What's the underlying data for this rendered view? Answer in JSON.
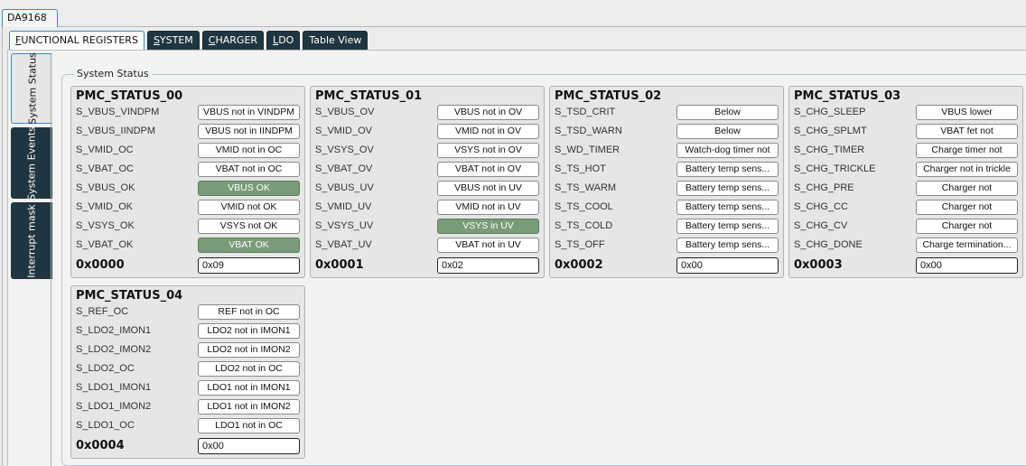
{
  "device": {
    "label": "DA9168"
  },
  "tabs": [
    {
      "prefix": "F",
      "rest": "UNCTIONAL REGISTERS",
      "active": true
    },
    {
      "prefix": "S",
      "rest": "YSTEM",
      "active": false
    },
    {
      "prefix": "C",
      "rest": "HARGER",
      "active": false
    },
    {
      "prefix": "L",
      "rest": "DO",
      "active": false
    },
    {
      "prefix": "",
      "rest": "Table View",
      "active": false
    }
  ],
  "side_tabs": [
    {
      "label": "System Status",
      "active": true
    },
    {
      "label": "System Events",
      "active": false
    },
    {
      "label": "Interrupt mask",
      "active": false
    }
  ],
  "group": {
    "label": "System Status"
  },
  "registers": [
    {
      "title": "PMC_STATUS_00",
      "address": "0x0000",
      "value": "0x09",
      "rows": [
        {
          "name": "S_VBUS_VINDPM",
          "value": "VBUS not in VINDPM",
          "on": false
        },
        {
          "name": "S_VBUS_IINDPM",
          "value": "VBUS not in IINDPM",
          "on": false
        },
        {
          "name": "S_VMID_OC",
          "value": "VMID not in OC",
          "on": false
        },
        {
          "name": "S_VBAT_OC",
          "value": "VBAT not in OC",
          "on": false
        },
        {
          "name": "S_VBUS_OK",
          "value": "VBUS OK",
          "on": true
        },
        {
          "name": "S_VMID_OK",
          "value": "VMID not OK",
          "on": false
        },
        {
          "name": "S_VSYS_OK",
          "value": "VSYS not OK",
          "on": false
        },
        {
          "name": "S_VBAT_OK",
          "value": "VBAT OK",
          "on": true
        }
      ]
    },
    {
      "title": "PMC_STATUS_01",
      "address": "0x0001",
      "value": "0x02",
      "rows": [
        {
          "name": "S_VBUS_OV",
          "value": "VBUS not in OV",
          "on": false
        },
        {
          "name": "S_VMID_OV",
          "value": "VMID not in OV",
          "on": false
        },
        {
          "name": "S_VSYS_OV",
          "value": "VSYS not in OV",
          "on": false
        },
        {
          "name": "S_VBAT_OV",
          "value": "VBAT not in OV",
          "on": false
        },
        {
          "name": "S_VBUS_UV",
          "value": "VBUS not in UV",
          "on": false
        },
        {
          "name": "S_VMID_UV",
          "value": "VMID not in UV",
          "on": false
        },
        {
          "name": "S_VSYS_UV",
          "value": "VSYS in UV",
          "on": true
        },
        {
          "name": "S_VBAT_UV",
          "value": "VBAT not in UV",
          "on": false
        }
      ]
    },
    {
      "title": "PMC_STATUS_02",
      "address": "0x0002",
      "value": "0x00",
      "rows": [
        {
          "name": "S_TSD_CRIT",
          "value": "Below",
          "on": false
        },
        {
          "name": "S_TSD_WARN",
          "value": "Below",
          "on": false
        },
        {
          "name": "S_WD_TIMER",
          "value": "Watch-dog timer not",
          "on": false
        },
        {
          "name": "S_TS_HOT",
          "value": "Battery temp sens...",
          "on": false
        },
        {
          "name": "S_TS_WARM",
          "value": "Battery temp sens...",
          "on": false
        },
        {
          "name": "S_TS_COOL",
          "value": "Battery temp sens...",
          "on": false
        },
        {
          "name": "S_TS_COLD",
          "value": "Battery temp sens...",
          "on": false
        },
        {
          "name": "S_TS_OFF",
          "value": "Battery temp sens...",
          "on": false
        }
      ]
    },
    {
      "title": "PMC_STATUS_03",
      "address": "0x0003",
      "value": "0x00",
      "rows": [
        {
          "name": "S_CHG_SLEEP",
          "value": "VBUS lower",
          "on": false
        },
        {
          "name": "S_CHG_SPLMT",
          "value": "VBAT fet not",
          "on": false
        },
        {
          "name": "S_CHG_TIMER",
          "value": "Charge timer not",
          "on": false
        },
        {
          "name": "S_CHG_TRICKLE",
          "value": "Charger not in trickle",
          "on": false
        },
        {
          "name": "S_CHG_PRE",
          "value": "Charger not",
          "on": false
        },
        {
          "name": "S_CHG_CC",
          "value": "Charger not",
          "on": false
        },
        {
          "name": "S_CHG_CV",
          "value": "Charger not",
          "on": false
        },
        {
          "name": "S_CHG_DONE",
          "value": "Charge termination...",
          "on": false
        }
      ]
    },
    {
      "title": "PMC_STATUS_04",
      "address": "0x0004",
      "value": "0x00",
      "rows": [
        {
          "name": "S_REF_OC",
          "value": "REF not in OC",
          "on": false
        },
        {
          "name": "S_LDO2_IMON1",
          "value": "LDO2 not in IMON1",
          "on": false
        },
        {
          "name": "S_LDO2_IMON2",
          "value": "LDO2 not in IMON2",
          "on": false
        },
        {
          "name": "S_LDO2_OC",
          "value": "LDO2 not in OC",
          "on": false
        },
        {
          "name": "S_LDO1_IMON1",
          "value": "LDO1 not in IMON1",
          "on": false
        },
        {
          "name": "S_LDO1_IMON2",
          "value": "LDO1 not in IMON2",
          "on": false
        },
        {
          "name": "S_LDO1_OC",
          "value": "LDO1 not in OC",
          "on": false
        }
      ]
    }
  ]
}
